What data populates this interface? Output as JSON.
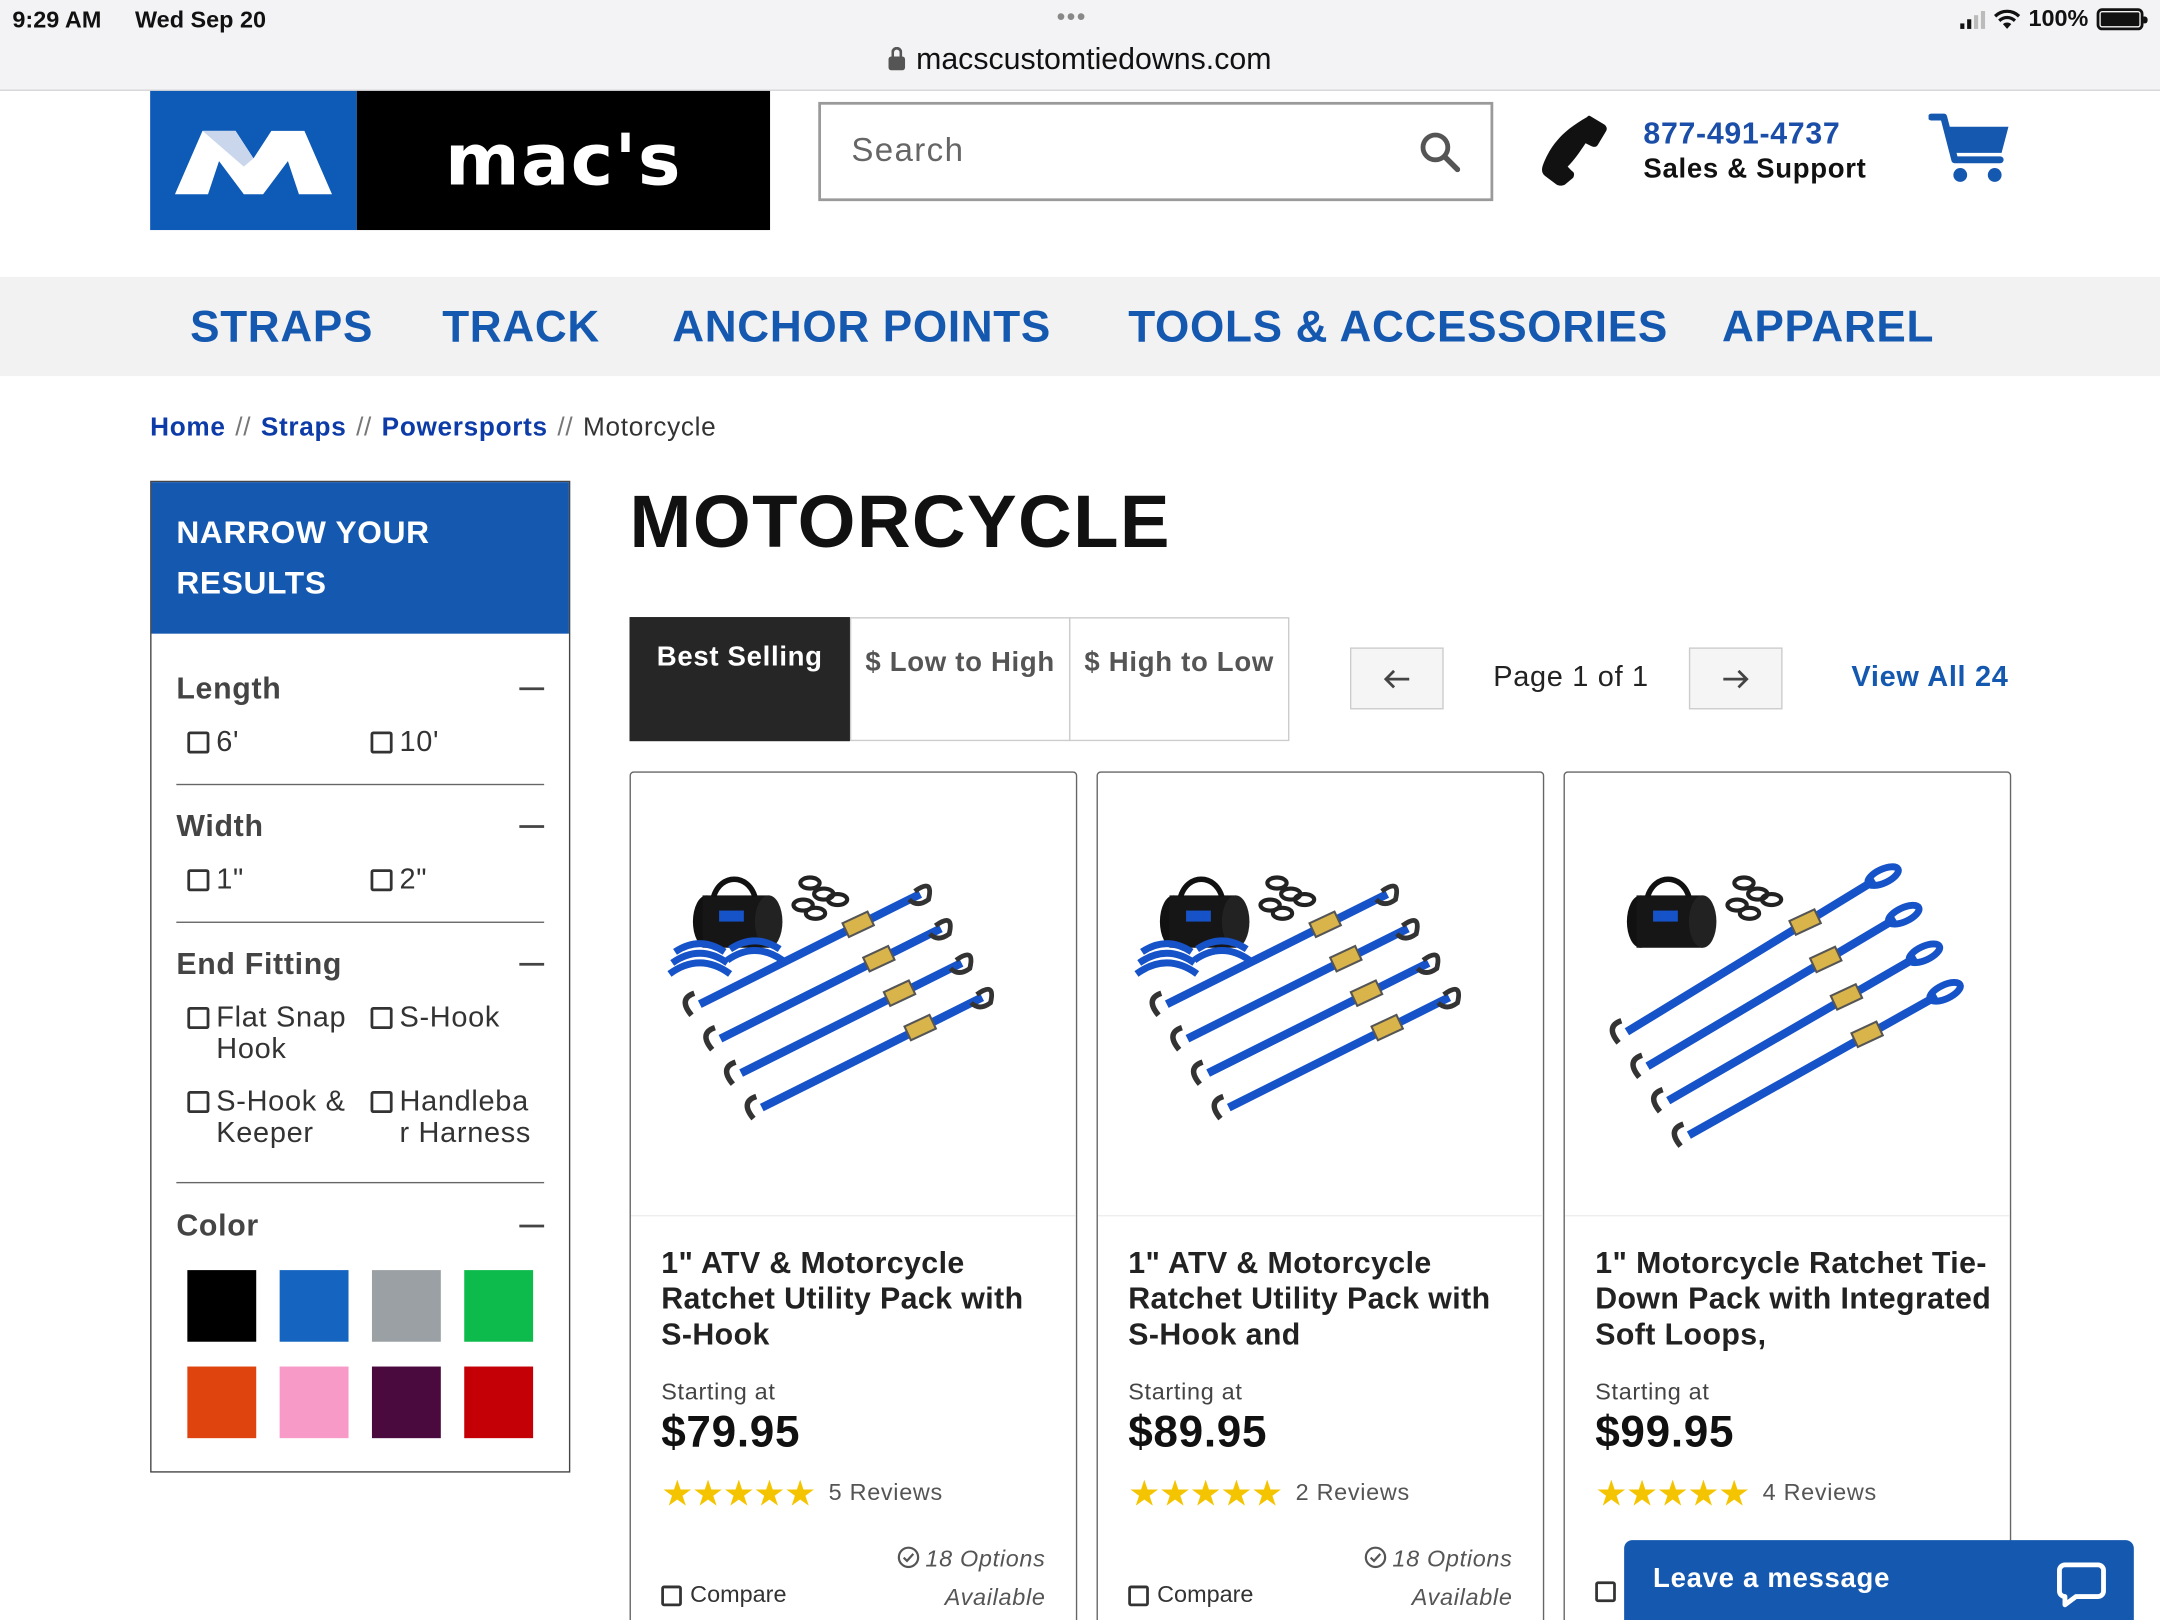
{
  "statusbar": {
    "time": "9:29 AM",
    "date": "Wed Sep 20",
    "dots": "•••",
    "battery": "100%",
    "battery_level": 1.0
  },
  "browser": {
    "url": "macscustomtiedowns.com"
  },
  "header": {
    "logo_text": "mac's",
    "search_placeholder": "Search",
    "phone": "877-491-4737",
    "phone_sub": "Sales & Support"
  },
  "nav": {
    "items": [
      "STRAPS",
      "TRACK",
      "ANCHOR POINTS",
      "TOOLS & ACCESSORIES",
      "APPAREL"
    ]
  },
  "breadcrumb": {
    "items": [
      "Home",
      "Straps",
      "Powersports"
    ],
    "separator": "//",
    "current": "Motorcycle"
  },
  "sidebar": {
    "title": "NARROW YOUR RESULTS",
    "facets": {
      "length": {
        "title": "Length",
        "options": [
          "6'",
          "10'"
        ]
      },
      "width": {
        "title": "Width",
        "options": [
          "1\"",
          "2\""
        ]
      },
      "end_fitting": {
        "title": "End Fitting",
        "options": [
          "Flat Snap Hook",
          "S-Hook",
          "S-Hook & Keeper",
          "Handlebar Harness"
        ]
      },
      "color": {
        "title": "Color",
        "swatches": [
          "#000000",
          "#1565c0",
          "#9aa0a4",
          "#0dbb4c",
          "#e0440e",
          "#f79ac8",
          "#4a0a3e",
          "#c40006"
        ]
      }
    }
  },
  "main": {
    "title": "MOTORCYCLE",
    "sort": [
      "Best Selling",
      "$ Low to High",
      "$ High to Low"
    ],
    "pagination": {
      "text": "Page 1 of 1",
      "view_all": "View All 24"
    }
  },
  "products": [
    {
      "title": "1\" ATV & Motorcycle Ratchet Utility Pack with S-Hook",
      "starting": "Starting at",
      "price": "$79.95",
      "rating": 5,
      "reviews": "5 Reviews",
      "options": "18 Options",
      "available": "Available",
      "compare": "Compare"
    },
    {
      "title": "1\" ATV & Motorcycle Ratchet Utility Pack with S-Hook and",
      "starting": "Starting at",
      "price": "$89.95",
      "rating": 5,
      "reviews": "2 Reviews",
      "options": "18 Options",
      "available": "Available",
      "compare": "Compare"
    },
    {
      "title": "1\" Motorcycle Ratchet Tie-Down Pack with Integrated Soft Loops,",
      "starting": "Starting at",
      "price": "$99.95",
      "rating": 5,
      "reviews": "4 Reviews",
      "options": "",
      "available": "",
      "compare": ""
    }
  ],
  "chat": {
    "label": "Leave a message"
  },
  "icons": {
    "search": "search-icon",
    "phone": "phone-icon",
    "cart": "cart-icon",
    "chat": "chat-bubble-icon",
    "prev": "arrow-left-icon",
    "next": "arrow-right-icon"
  },
  "colors": {
    "brand_blue": "#1558b0",
    "link_blue": "#0d3ba8",
    "star": "#f5c400"
  }
}
